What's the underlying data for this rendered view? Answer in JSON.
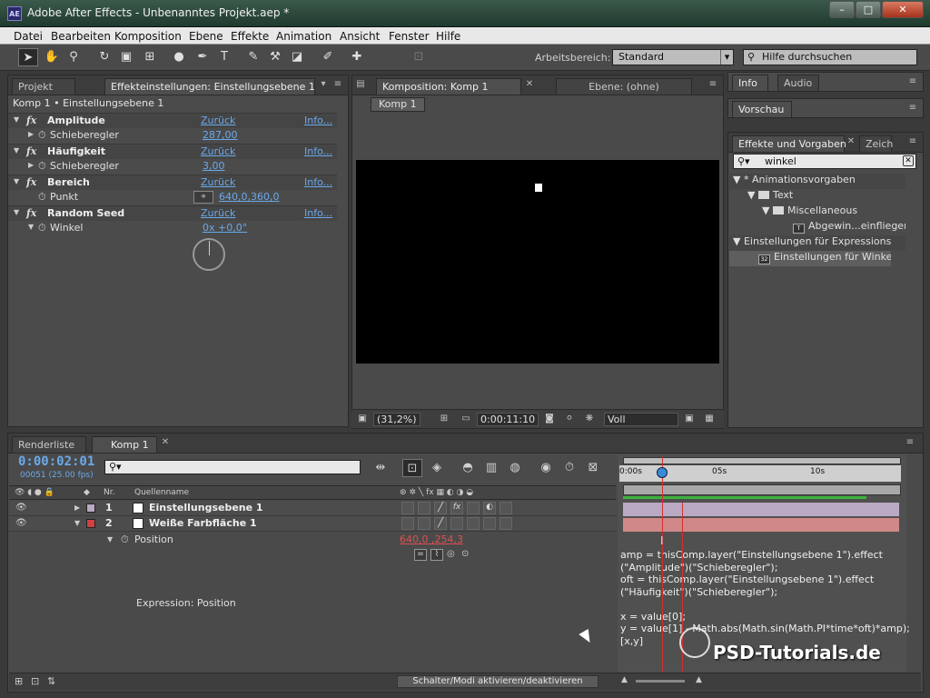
{
  "window": {
    "app_icon": "AE",
    "title": "Adobe After Effects - Unbenanntes Projekt.aep *",
    "minimize": "–",
    "maximize": "□",
    "close": "✕"
  },
  "menu": [
    "Datei",
    "Bearbeiten",
    "Komposition",
    "Ebene",
    "Effekte",
    "Animation",
    "Ansicht",
    "Fenster",
    "Hilfe"
  ],
  "toolbar": {
    "tools": [
      "arrow-tool-icon",
      "hand-tool-icon",
      "zoom-tool-icon",
      "rotate-tool-icon",
      "camera-tool-icon",
      "pan-behind-tool-icon",
      "ellipse-tool-icon",
      "pen-tool-icon",
      "text-tool-icon",
      "brush-tool-icon",
      "clone-stamp-tool-icon",
      "eraser-tool-icon",
      "puppet-pin-tool-icon"
    ],
    "workspace_label": "Arbeitsbereich:",
    "workspace_value": "Standard",
    "help_search_placeholder": "Hilfe durchsuchen"
  },
  "effect_panel": {
    "tab_project": "Projekt",
    "tab_effect": "Effekteinstellungen: Einstellungsebene 1",
    "breadcrumb": "Komp 1 • Einstellungsebene 1",
    "effects": [
      {
        "name": "Amplitude",
        "reset": "Zurück",
        "info": "Info...",
        "param": "Schieberegler",
        "value": "287,00"
      },
      {
        "name": "Häufigkeit",
        "reset": "Zurück",
        "info": "Info...",
        "param": "Schieberegler",
        "value": "3,00"
      },
      {
        "name": "Bereich",
        "reset": "Zurück",
        "info": "Info...",
        "param": "Punkt",
        "value": "640,0,360,0"
      },
      {
        "name": "Random Seed",
        "reset": "Zurück",
        "info": "Info...",
        "param": "Winkel",
        "value": "0x +0,0°"
      }
    ]
  },
  "comp_panel": {
    "tab_comp": "Komposition: Komp 1",
    "tab_layer": "Ebene: (ohne)",
    "flowchart_chip": "Komp 1",
    "zoom": "(31,2%)",
    "time": "0:00:11:10",
    "resolution": "Voll"
  },
  "right_panels": {
    "tab_info": "Info",
    "tab_audio": "Audio",
    "tab_preview": "Vorschau",
    "tab_effects": "Effekte und Vorgaben",
    "tab_char": "Zeich",
    "search_value": "winkel",
    "tree": [
      {
        "label": "* Animationsvorgaben",
        "indent": 0,
        "kind": "header"
      },
      {
        "label": "Text",
        "indent": 1,
        "kind": "folder"
      },
      {
        "label": "Miscellaneous",
        "indent": 2,
        "kind": "folder"
      },
      {
        "label": "Abgewin...einfliegen",
        "indent": 3,
        "kind": "preset"
      },
      {
        "label": "Einstellungen für Expressions",
        "indent": 0,
        "kind": "header"
      },
      {
        "label": "Einstellungen für Winkel",
        "indent": 2,
        "kind": "preset-selected"
      }
    ]
  },
  "timeline": {
    "tab_render": "Renderliste",
    "tab_comp": "Komp 1",
    "timecode": "0:00:02:01",
    "frame_info": "00051 (25.00 fps)",
    "search_placeholder": "",
    "col_nr": "Nr.",
    "col_source": "Quellenname",
    "layers": [
      {
        "num": "1",
        "name": "Einstellungsebene 1",
        "color": "#b9a9c2"
      },
      {
        "num": "2",
        "name": "Weiße Farbfläche 1",
        "color": "#d04040"
      }
    ],
    "position_label": "Position",
    "position_value": "640,0 ,254,3",
    "expression_label": "Expression: Position",
    "expression_code": "amp = thisComp.layer(\"Einstellungsebene 1\").effect\n(\"Amplitude\")(\"Schieberegler\");\noft = thisComp.layer(\"Einstellungsebene 1\").effect\n(\"Häufigkeit\")(\"Schieberegler\");\n\nx = value[0];\ny = value[1] - Math.abs(Math.sin(Math.PI*time*oft)*amp);\n[x,y]",
    "ruler": [
      "0:00s",
      "05s",
      "10s"
    ],
    "toggle_switches": "Schalter/Modi aktivieren/deaktivieren",
    "watermark": "PSD-Tutorials.de"
  },
  "colors": {
    "accent_blue": "#6aa9ea",
    "value_red": "#e05050",
    "cti_red": "#d23030"
  }
}
